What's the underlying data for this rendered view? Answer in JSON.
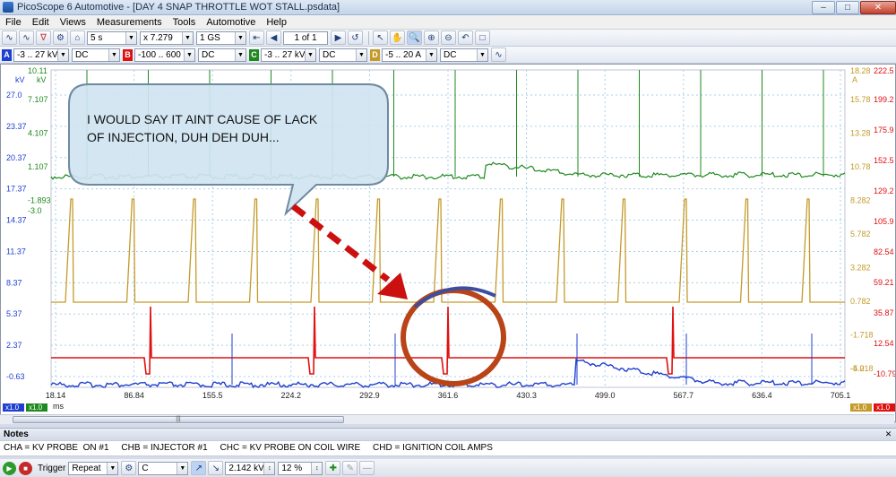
{
  "window": {
    "title": "PicoScope 6 Automotive - [DAY 4 SNAP THROTTLE WOT STALL.psdata]"
  },
  "menu": [
    "File",
    "Edit",
    "Views",
    "Measurements",
    "Tools",
    "Automotive",
    "Help"
  ],
  "toolbar": {
    "timebase": "5 s",
    "zoom": "x 7.279",
    "samples": "1 GS",
    "buffer": "1 of 1"
  },
  "channels": [
    {
      "id": "A",
      "range": "-3 .. 27 kV",
      "coupling": "DC",
      "color": "#1f3fd0"
    },
    {
      "id": "B",
      "range": "-100 .. 600",
      "coupling": "DC",
      "color": "#e01010"
    },
    {
      "id": "C",
      "range": "-3 .. 27 kV",
      "coupling": "DC",
      "color": "#1e8a1e"
    },
    {
      "id": "D",
      "range": "-5 .. 20 A",
      "coupling": "DC",
      "color": "#c49a2a"
    }
  ],
  "axes": {
    "a_unit": "kV",
    "a_ticks": [
      "27.0",
      "23.37",
      "20.37",
      "17.37",
      "14.37",
      "11.37",
      "8.37",
      "5.37",
      "2.37",
      "-0.63"
    ],
    "c_unit": "kV",
    "c_ticks": [
      "10.11",
      "7.107",
      "4.107",
      "1.107",
      "-1.893",
      "-3.0"
    ],
    "d_unit": "A",
    "d_ticks": [
      "18.28",
      "15.78",
      "13.28",
      "10.78",
      "8.282",
      "5.782",
      "3.282",
      "0.782",
      "-1.718",
      "-4.218",
      "-5.0"
    ],
    "b_unit": "V",
    "b_ticks": [
      "222.5",
      "199.2",
      "175.9",
      "152.5",
      "129.2",
      "105.9",
      "82.54",
      "59.21",
      "35.87",
      "12.54",
      "-10.79"
    ],
    "x_unit": "ms",
    "x_ticks": [
      "18.14",
      "86.84",
      "155.5",
      "224.2",
      "292.9",
      "361.6",
      "430.3",
      "499.0",
      "567.7",
      "636.4",
      "705.1"
    ],
    "left_scale_badges": [
      "x1.0",
      "x1.0"
    ],
    "right_scale_badges": [
      "x1.0",
      "x1.0"
    ]
  },
  "annotation": {
    "callout_lines": [
      "I WOULD SAY IT AINT CAUSE OF LACK",
      "OF INJECTION, DUH DEH DUH..."
    ]
  },
  "notes": {
    "header": "Notes",
    "text": "CHA = KV PROBE  ON #1     CHB = INJECTOR #1     CHC = KV PROBE ON COIL WIRE     CHD = IGNITION COIL AMPS"
  },
  "trigger": {
    "label": "Trigger",
    "mode": "Repeat",
    "source": "C",
    "level": "2.142 kV",
    "pretrigger": "12 %"
  }
}
